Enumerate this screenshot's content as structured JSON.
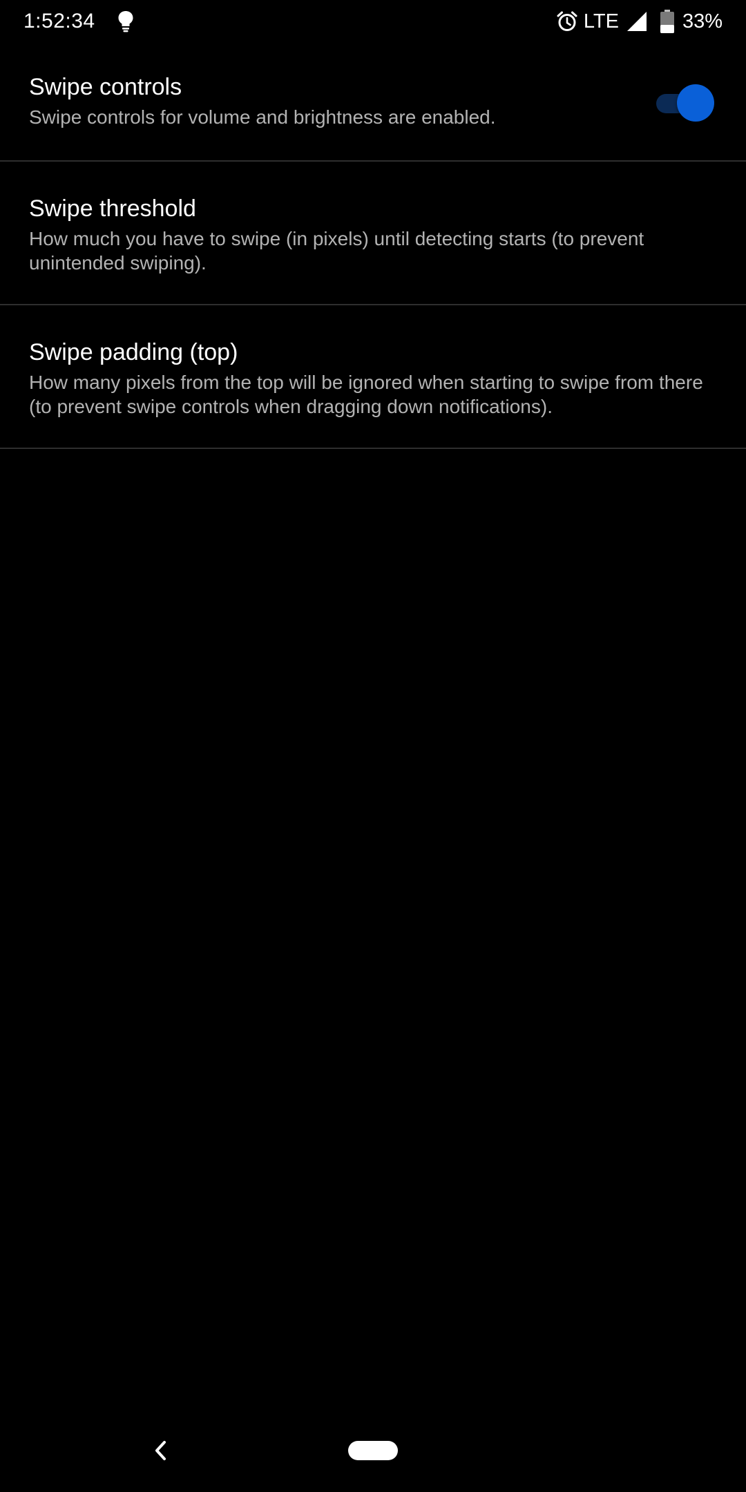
{
  "status_bar": {
    "time": "1:52:34",
    "network": "LTE",
    "battery": "33%",
    "icons": [
      "lightbulb-icon",
      "alarm-icon",
      "signal-icon",
      "battery-icon"
    ]
  },
  "settings": [
    {
      "title": "Swipe controls",
      "summary": "Swipe controls for volume and brightness are enabled.",
      "has_switch": true,
      "switch_on": true
    },
    {
      "title": "Swipe threshold",
      "summary": "How much you have to swipe (in pixels) until detecting starts (to prevent unintended swiping)."
    },
    {
      "title": "Swipe padding (top)",
      "summary": "How many pixels from the top will be ignored when starting to swipe from there (to prevent swipe controls when dragging down notifications)."
    }
  ],
  "nav_bar": {
    "icons": [
      "back-icon",
      "home-pill"
    ]
  },
  "colors": {
    "background": "#000000",
    "accent": "#0a60d8",
    "switch_track_on": "#0b2a55",
    "divider": "#2e2e2e",
    "summary_text": "#b3b3b3"
  }
}
